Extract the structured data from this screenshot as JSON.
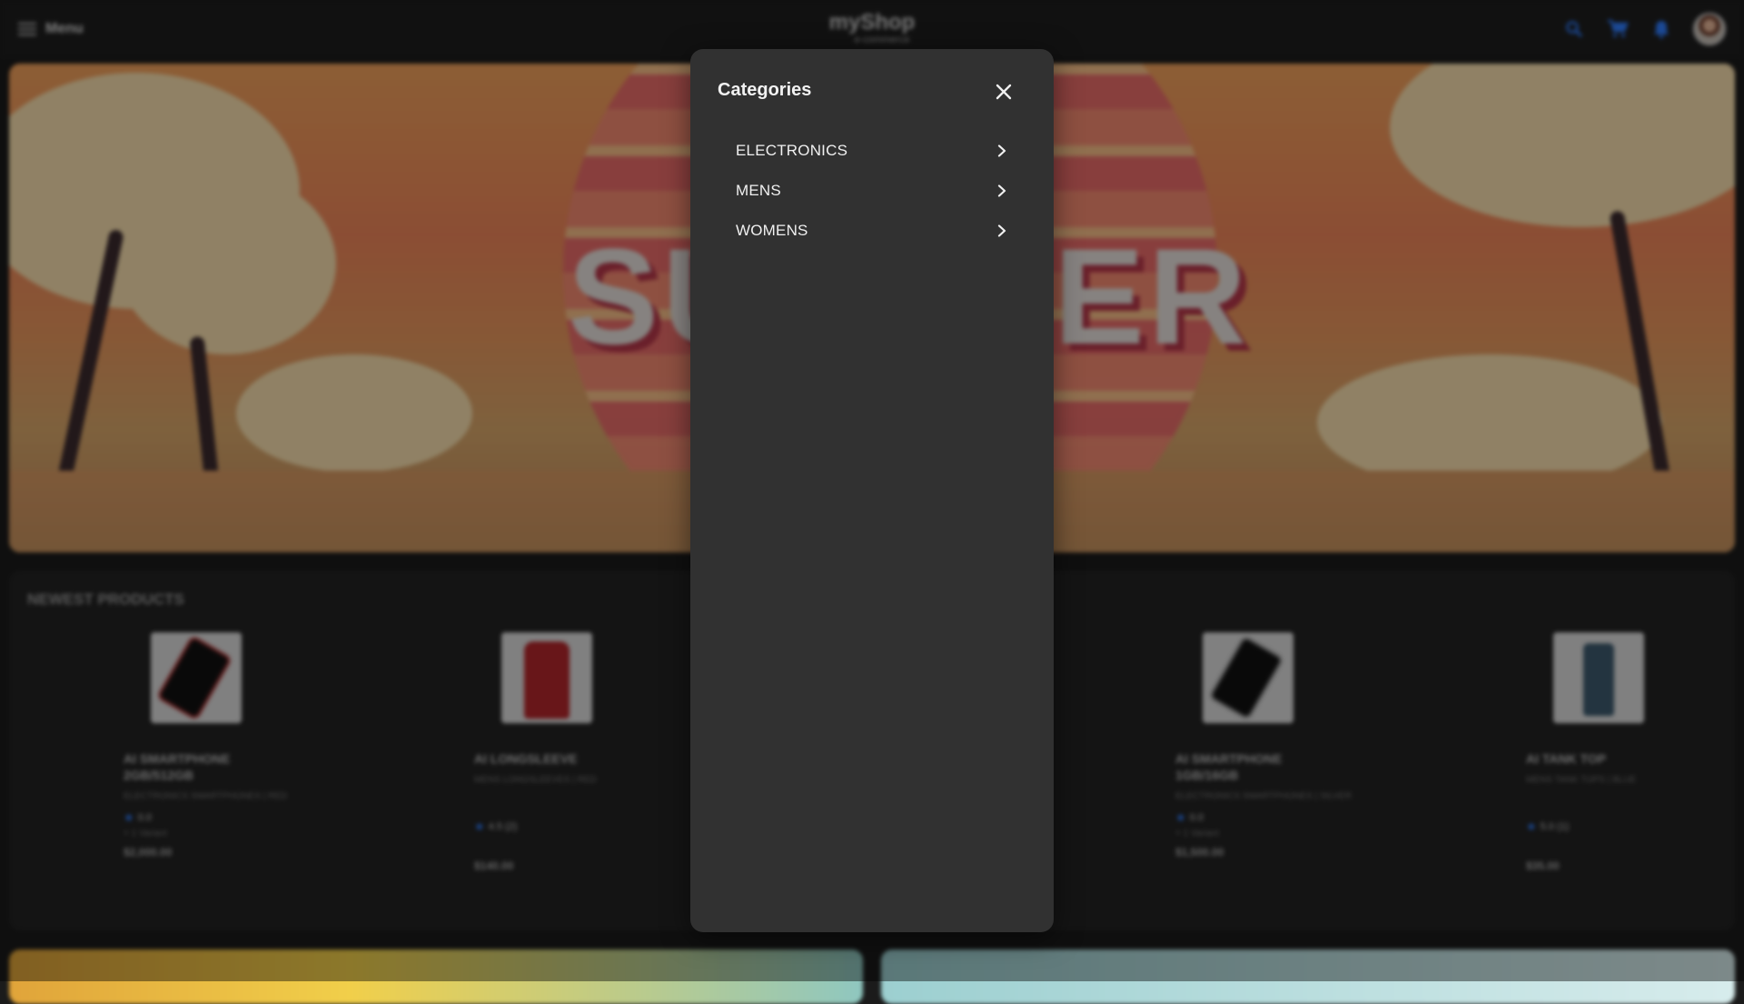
{
  "header": {
    "menu_label": "Menu",
    "logo_title": "myShop",
    "logo_subtitle": "e-commerce",
    "icons": [
      "search-icon",
      "cart-icon",
      "bell-icon",
      "avatar"
    ]
  },
  "hero": {
    "word_left": "SU",
    "word_right": "ER"
  },
  "newest": {
    "title": "NEWEST PRODUCTS",
    "products": [
      {
        "name": "AI SMARTPHONE 2GB/512GB",
        "category": "ELECTRONICS SMARTPHONES | RED",
        "rating": "0.0",
        "variant": "+ 1 Variant",
        "price": "$2,000.00"
      },
      {
        "name": "AI LONGSLEEVE",
        "category": "MENS LONGSLEEVES | RED",
        "rating": "4.5 (2)",
        "variant": "",
        "price": "$140.00"
      },
      {
        "name": "AI SMARTPHONE 1GB/16GB",
        "category": "ELECTRONICS SMARTPHONES | SILVER",
        "rating": "0.0",
        "variant": "+ 1 Variant",
        "price": "$1,500.00"
      },
      {
        "name": "AI TANK TOP",
        "category": "MENS TANK TOPS | BLUE",
        "rating": "5.0 (1)",
        "variant": "",
        "price": "$35.00"
      }
    ]
  },
  "modal": {
    "title": "Categories",
    "categories": [
      {
        "label": "ELECTRONICS"
      },
      {
        "label": "MENS"
      },
      {
        "label": "WOMENS"
      }
    ]
  },
  "colors": {
    "accent": "#2f7dff",
    "modal_bg": "#313131",
    "page_bg": "#1b1b1b"
  }
}
